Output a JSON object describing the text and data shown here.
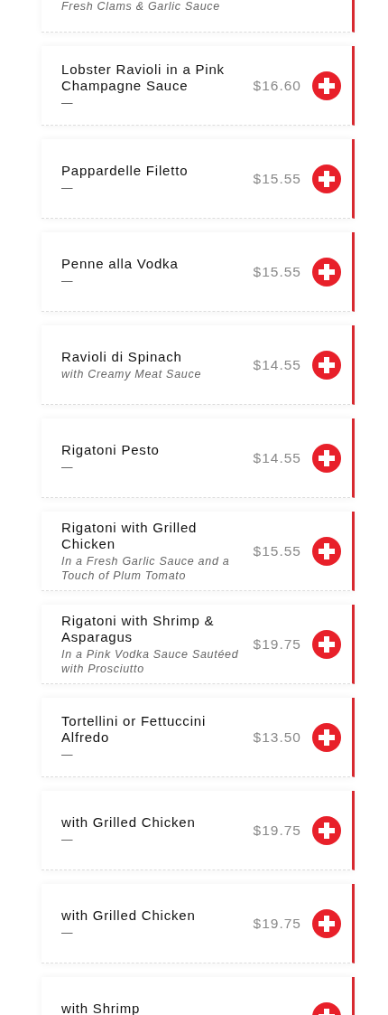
{
  "menu_items": [
    {
      "description": "Fresh Clams & Garlic Sauce"
    },
    {
      "title": "Lobster Ravioli in a Pink Champagne Sauce",
      "description": "—",
      "price": "$16.60"
    },
    {
      "title": "Pappardelle Filetto",
      "description": "—",
      "price": "$15.55"
    },
    {
      "title": "Penne alla Vodka",
      "description": "—",
      "price": "$15.55"
    },
    {
      "title": "Ravioli di Spinach",
      "description": "with Creamy Meat Sauce",
      "price": "$14.55"
    },
    {
      "title": "Rigatoni Pesto",
      "description": "—",
      "price": "$14.55"
    },
    {
      "title": "Rigatoni with Grilled Chicken",
      "description": "In a Fresh Garlic Sauce and a Touch of Plum Tomato",
      "price": "$15.55"
    },
    {
      "title": "Rigatoni with Shrimp & Asparagus",
      "description": "In a Pink Vodka Sauce Sautéed with Prosciutto",
      "price": "$19.75"
    },
    {
      "title": "Tortellini or Fettuccini Alfredo",
      "description": "—",
      "price": "$13.50"
    },
    {
      "title": "with Grilled Chicken",
      "description": "—",
      "price": "$19.75"
    },
    {
      "title": "with Grilled Chicken",
      "description": "—",
      "price": "$19.75"
    },
    {
      "title": "with Shrimp"
    }
  ]
}
